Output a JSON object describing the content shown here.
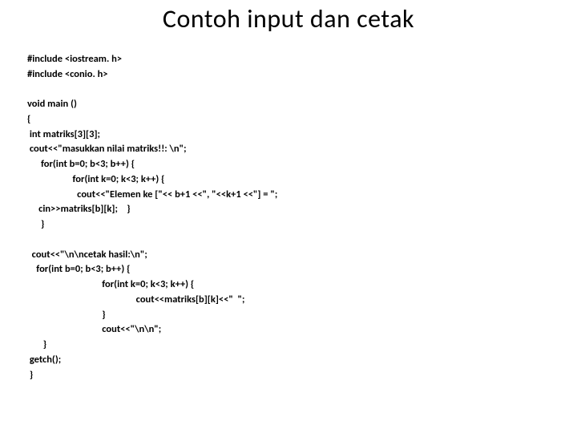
{
  "title": "Contoh input dan cetak",
  "code": {
    "l01": "#include <iostream. h>",
    "l02": "#include <conio. h>",
    "l03": "",
    "l04": "void main ()",
    "l05": "{",
    "l06": " int matriks[3][3];",
    "l07": " cout<<\"masukkan nilai matriks!!: \\n\";",
    "l08": "      for(int b=0; b<3; b++) {",
    "l09": "                    for(int k=0; k<3; k++) {",
    "l10": "                      cout<<\"Elemen ke [\"<< b+1 <<\", \"<<k+1 <<\"] = \";",
    "l11": "     cin>>matriks[b][k];    }",
    "l12": "      }",
    "l13": "",
    "l14": "  cout<<\"\\n\\ncetak hasil:\\n\";",
    "l15": "    for(int b=0; b<3; b++) {",
    "l16": "                                 for(int k=0; k<3; k++) {",
    "l17": "                                                cout<<matriks[b][k]<<\"  \";",
    "l18": "                                 }",
    "l19": "                                 cout<<\"\\n\\n\";",
    "l20": "       }",
    "l21": " getch();",
    "l22": " }"
  }
}
